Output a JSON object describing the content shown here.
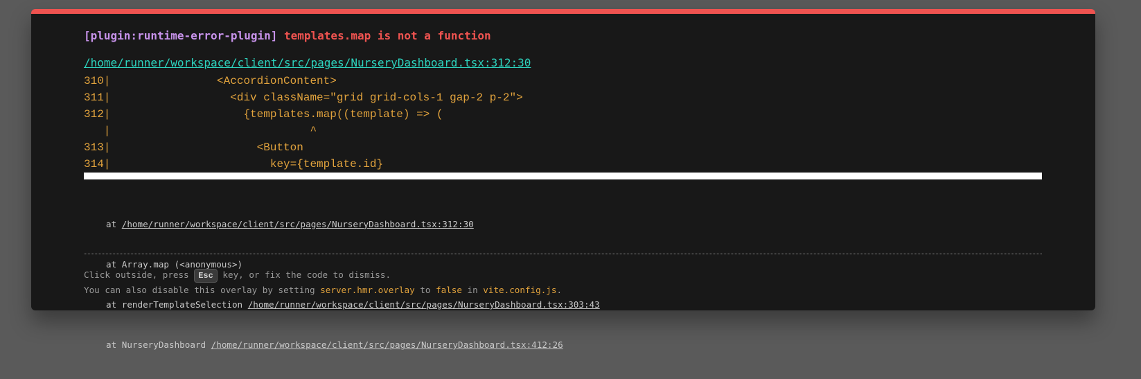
{
  "error": {
    "plugin": "[plugin:runtime-error-plugin]",
    "message": "templates.map is not a function",
    "file_link": "/home/runner/workspace/client/src/pages/NurseryDashboard.tsx:312:30"
  },
  "code_frame": [
    "310|                <AccordionContent>",
    "311|                  <div className=\"grid grid-cols-1 gap-2 p-2\">",
    "312|                    {templates.map((template) => (",
    "   |                              ^",
    "313|                      <Button",
    "314|                        key={template.id}"
  ],
  "stack": [
    {
      "prefix": "at ",
      "link": "/home/runner/workspace/client/src/pages/NurseryDashboard.tsx:312:30"
    },
    {
      "prefix": "at Array.map (<anonymous>)",
      "link": ""
    },
    {
      "prefix": "at renderTemplateSelection ",
      "link": "/home/runner/workspace/client/src/pages/NurseryDashboard.tsx:303:43"
    },
    {
      "prefix": "at NurseryDashboard ",
      "link": "/home/runner/workspace/client/src/pages/NurseryDashboard.tsx:412:26"
    }
  ],
  "tips": {
    "line1_before": "Click outside, press ",
    "esc_key": "Esc",
    "line1_after": " key, or fix the code to dismiss.",
    "line2_prefix": "You can also disable this overlay by setting ",
    "setting": "server.hmr.overlay",
    "to": " to ",
    "value": "false",
    "in": " in ",
    "config_file": "vite.config.js",
    "period": "."
  },
  "colors": {
    "accent": "#ef5350",
    "plugin": "#c792ea",
    "link": "#2dd4bf",
    "code": "#e2a33d",
    "background": "#181818",
    "backdrop": "#5a5a5a"
  }
}
